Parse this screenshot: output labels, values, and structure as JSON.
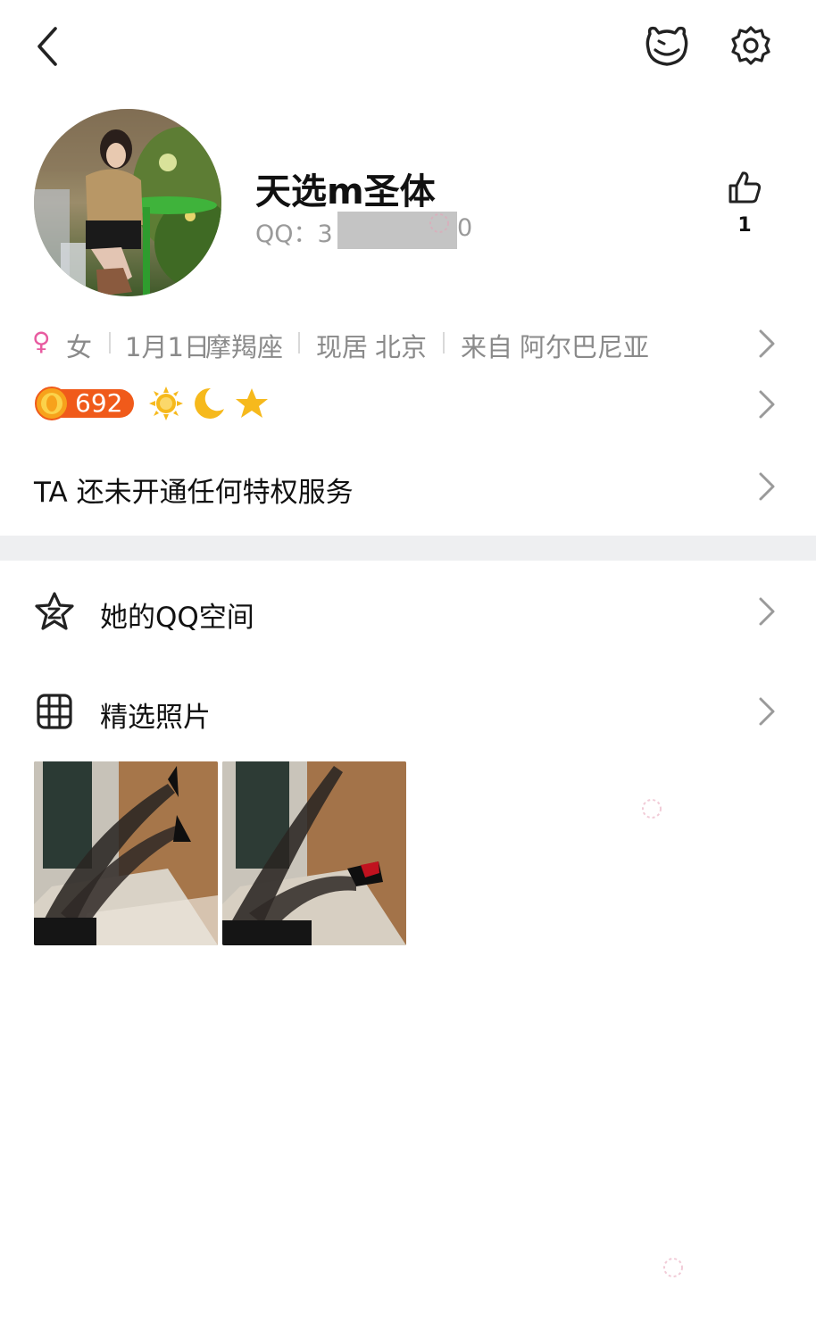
{
  "header": {
    "back_icon": "chevron-left-icon",
    "pet_icon": "pet-icon",
    "settings_icon": "gear-icon"
  },
  "profile": {
    "nickname": "天选m圣体",
    "qq_prefix": "QQ：3",
    "qq_suffix": "0",
    "like_count": "1"
  },
  "info_row": {
    "gender_symbol": "♀",
    "gender": "女",
    "birthday": "1月1日",
    "zodiac": "摩羯座",
    "residence_label": "现居",
    "residence": "北京",
    "hometown_label": "来自",
    "hometown": "阿尔巴尼亚"
  },
  "level_row": {
    "level_value": "692",
    "badges": [
      "sun-icon",
      "moon-icon",
      "star-icon"
    ]
  },
  "privilege_text": "TA 还未开通任何特权服务",
  "menu": {
    "qzone_label": "她的QQ空间",
    "photos_label": "精选照片"
  },
  "colors": {
    "accent_pink": "#e85ba0",
    "level_orange": "#f05a1a",
    "badge_gold": "#f6b91c",
    "divider": "#eeeff1"
  }
}
